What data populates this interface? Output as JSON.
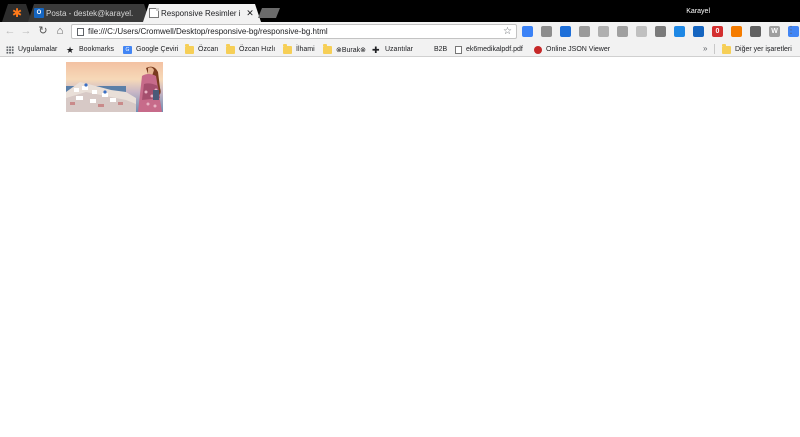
{
  "tabs": [
    {
      "title": "",
      "favicon": "orange-star-icon"
    },
    {
      "title": "Posta - destek@karayel.",
      "favicon": "outlook-icon",
      "badge": "O"
    },
    {
      "title": "Responsive Resimler ile ...",
      "favicon": "document-icon",
      "close": "✕",
      "active": true
    }
  ],
  "profile": {
    "name": "Karayel"
  },
  "toolbar": {
    "url": "file:///C:/Users/Cromwell/Desktop/responsive-bg/responsive-bg.html",
    "back": "←",
    "forward": "→",
    "reload": "↻",
    "home": "⌂",
    "star": "☆",
    "menu": "⋮",
    "extensions": [
      {
        "icon": "extension-blue-icon",
        "color": "#3b82f6",
        "glyph": ""
      },
      {
        "icon": "extension-grey-icon",
        "color": "#8e8e8e",
        "glyph": ""
      },
      {
        "icon": "shield-icon",
        "color": "#1e6fd9",
        "glyph": ""
      },
      {
        "icon": "extension-grey-icon",
        "color": "#9a9a9a",
        "glyph": ""
      },
      {
        "icon": "extension-grey-icon",
        "color": "#b0b0b0",
        "glyph": ""
      },
      {
        "icon": "extension-grey-icon",
        "color": "#a0a0a0",
        "glyph": ""
      },
      {
        "icon": "extension-grey-icon",
        "color": "#c0c0c0",
        "glyph": ""
      },
      {
        "icon": "camera-icon",
        "color": "#7a7a7a",
        "glyph": ""
      },
      {
        "icon": "download-icon",
        "color": "#1e88e5",
        "glyph": ""
      },
      {
        "icon": "new-badge-icon",
        "color": "#1565c0",
        "glyph": ""
      },
      {
        "icon": "red-circle-icon",
        "color": "#d32f2f",
        "glyph": "0"
      },
      {
        "icon": "orange-creature-icon",
        "color": "#f57c00",
        "glyph": ""
      },
      {
        "icon": "magnifier-icon",
        "color": "#616161",
        "glyph": ""
      },
      {
        "icon": "w-extension-icon",
        "color": "#9e9e9e",
        "glyph": "W"
      },
      {
        "icon": "translate-icon",
        "color": "#4285f4",
        "glyph": ""
      }
    ]
  },
  "bookmarks": {
    "items": [
      {
        "label": "Uygulamalar",
        "icon": "apps-grid-icon"
      },
      {
        "label": "Bookmarks",
        "icon": "star-icon"
      },
      {
        "label": "Google Çeviri",
        "icon": "google-translate-icon"
      },
      {
        "label": "Özcan",
        "icon": "folder-icon"
      },
      {
        "label": "Özcan Hızlı",
        "icon": "folder-icon"
      },
      {
        "label": "İlhami",
        "icon": "folder-icon"
      },
      {
        "label": "⊗Burak⊗",
        "icon": "folder-icon"
      },
      {
        "label": "Uzantılar",
        "icon": "puzzle-icon"
      },
      {
        "label": "B2B",
        "icon": "none"
      },
      {
        "label": "ek6medikalpdf.pdf",
        "icon": "document-icon"
      },
      {
        "label": "Online JSON Viewer",
        "icon": "json-viewer-icon"
      }
    ],
    "more": "»",
    "other": "Diğer yer işaretleri"
  }
}
